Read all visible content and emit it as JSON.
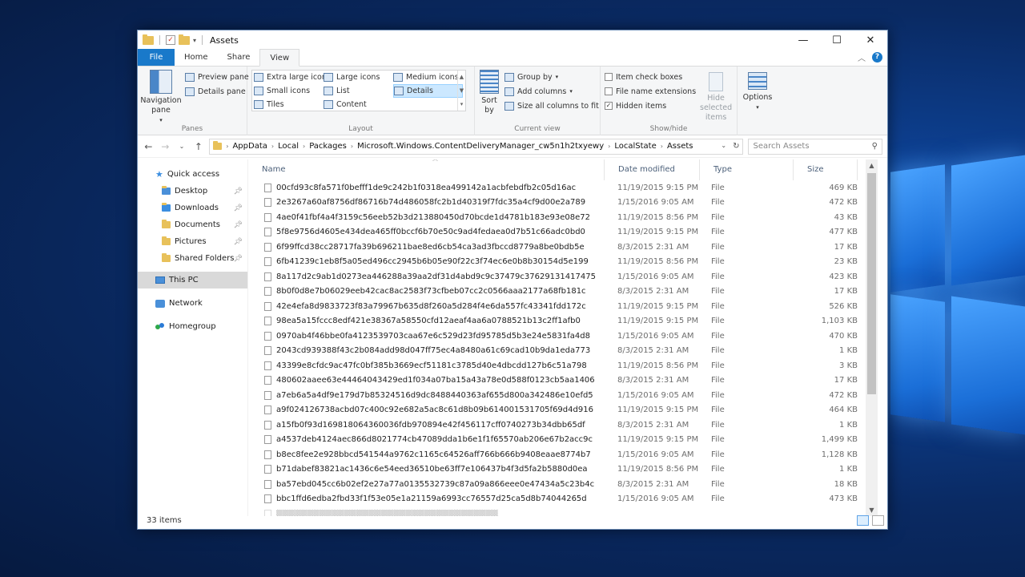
{
  "window": {
    "title": "Assets",
    "controls": {
      "minimize": "—",
      "maximize": "☐",
      "close": "✕"
    }
  },
  "tabs": [
    "File",
    "Home",
    "Share",
    "View"
  ],
  "active_tab": "View",
  "ribbon": {
    "panes": {
      "label": "Panes",
      "navigation_pane": "Navigation pane",
      "preview_pane": "Preview pane",
      "details_pane": "Details pane"
    },
    "layout": {
      "label": "Layout",
      "options": [
        "Extra large icons",
        "Large icons",
        "Medium icons",
        "Small icons",
        "List",
        "Details",
        "Tiles",
        "Content"
      ],
      "selected": "Details"
    },
    "current_view": {
      "label": "Current view",
      "sort_by": "Sort by",
      "group_by": "Group by",
      "add_columns": "Add columns",
      "size_all_columns": "Size all columns to fit"
    },
    "show_hide": {
      "label": "Show/hide",
      "item_check_boxes": "Item check boxes",
      "file_name_extensions": "File name extensions",
      "hidden_items": "Hidden items",
      "hide_selected_items": "Hide selected items"
    },
    "options": "Options"
  },
  "address": {
    "path": [
      "AppData",
      "Local",
      "Packages",
      "Microsoft.Windows.ContentDeliveryManager_cw5n1h2txyewy",
      "LocalState",
      "Assets"
    ],
    "search_placeholder": "Search Assets"
  },
  "nav": {
    "quick_access": "Quick access",
    "quick_items": [
      "Desktop",
      "Downloads",
      "Documents",
      "Pictures",
      "Shared Folders"
    ],
    "this_pc": "This PC",
    "network": "Network",
    "homegroup": "Homegroup"
  },
  "columns": {
    "name": "Name",
    "date": "Date modified",
    "type": "Type",
    "size": "Size"
  },
  "files": [
    {
      "name": "00cfd93c8fa571f0befff1de9c242b1f0318ea499142a1acbfebdfb2c05d16ac",
      "date": "11/19/2015 9:15 PM",
      "type": "File",
      "size": "469 KB"
    },
    {
      "name": "2e3267a60af8756df86716b74d486058fc2b1d40319f7fdc35a4cf9d00e2a789",
      "date": "1/15/2016 9:05 AM",
      "type": "File",
      "size": "472 KB"
    },
    {
      "name": "4ae0f41fbf4a4f3159c56eeb52b3d213880450d70bcde1d4781b183e93e08e72",
      "date": "11/19/2015 8:56 PM",
      "type": "File",
      "size": "43 KB"
    },
    {
      "name": "5f8e9756d4605e434dea465ff0bccf6b70e50c9ad4fedaea0d7b51c66adc0bd0",
      "date": "11/19/2015 9:15 PM",
      "type": "File",
      "size": "477 KB"
    },
    {
      "name": "6f99ffcd38cc28717fa39b696211bae8ed6cb54ca3ad3fbccd8779a8be0bdb5e",
      "date": "8/3/2015 2:31 AM",
      "type": "File",
      "size": "17 KB"
    },
    {
      "name": "6fb41239c1eb8f5a05ed496cc2945b6b05e90f22c3f74ec6e0b8b30154d5e199",
      "date": "11/19/2015 8:56 PM",
      "type": "File",
      "size": "23 KB"
    },
    {
      "name": "8a117d2c9ab1d0273ea446288a39aa2df31d4abd9c9c37479c37629131417475",
      "date": "1/15/2016 9:05 AM",
      "type": "File",
      "size": "423 KB"
    },
    {
      "name": "8b0f0d8e7b06029eeb42cac8ac2583f73cfbeb07cc2c0566aaa2177a68fb181c",
      "date": "8/3/2015 2:31 AM",
      "type": "File",
      "size": "17 KB"
    },
    {
      "name": "42e4efa8d9833723f83a79967b635d8f260a5d284f4e6da557fc43341fdd172c",
      "date": "11/19/2015 9:15 PM",
      "type": "File",
      "size": "526 KB"
    },
    {
      "name": "98ea5a15fccc8edf421e38367a58550cfd12aeaf4aa6a0788521b13c2ff1afb0",
      "date": "11/19/2015 9:15 PM",
      "type": "File",
      "size": "1,103 KB"
    },
    {
      "name": "0970ab4f46bbe0fa4123539703caa67e6c529d23fd95785d5b3e24e5831fa4d8",
      "date": "1/15/2016 9:05 AM",
      "type": "File",
      "size": "470 KB"
    },
    {
      "name": "2043cd939388f43c2b084add98d047ff75ec4a8480a61c69cad10b9da1eda773",
      "date": "8/3/2015 2:31 AM",
      "type": "File",
      "size": "1 KB"
    },
    {
      "name": "43399e8cfdc9ac47fc0bf385b3669ecf51181c3785d40e4dbcdd127b6c51a798",
      "date": "11/19/2015 8:56 PM",
      "type": "File",
      "size": "3 KB"
    },
    {
      "name": "480602aaee63e44464043429ed1f034a07ba15a43a78e0d588f0123cb5aa1406",
      "date": "8/3/2015 2:31 AM",
      "type": "File",
      "size": "17 KB"
    },
    {
      "name": "a7eb6a5a4df9e179d7b85324516d9dc8488440363af655d800a342486e10efd5",
      "date": "1/15/2016 9:05 AM",
      "type": "File",
      "size": "472 KB"
    },
    {
      "name": "a9f024126738acbd07c400c92e682a5ac8c61d8b09b614001531705f69d4d916",
      "date": "11/19/2015 9:15 PM",
      "type": "File",
      "size": "464 KB"
    },
    {
      "name": "a15fb0f93d169818064360036fdb970894e42f456117cff0740273b34dbb65df",
      "date": "8/3/2015 2:31 AM",
      "type": "File",
      "size": "1 KB"
    },
    {
      "name": "a4537deb4124aec866d8021774cb47089dda1b6e1f1f65570ab206e67b2acc9c",
      "date": "11/19/2015 9:15 PM",
      "type": "File",
      "size": "1,499 KB"
    },
    {
      "name": "b8ec8fee2e928bbcd541544a9762c1165c64526aff766b666b9408eaae8774b7",
      "date": "1/15/2016 9:05 AM",
      "type": "File",
      "size": "1,128 KB"
    },
    {
      "name": "b71dabef83821ac1436c6e54eed36510be63ff7e106437b4f3d5fa2b5880d0ea",
      "date": "11/19/2015 8:56 PM",
      "type": "File",
      "size": "1 KB"
    },
    {
      "name": "ba57ebd045cc6b02ef2e27a77a0135532739c87a09a866eee0e47434a5c23b4c",
      "date": "8/3/2015 2:31 AM",
      "type": "File",
      "size": "18 KB"
    },
    {
      "name": "bbc1ffd6edba2fbd33f1f53e05e1a21159a6993cc76557d25ca5d8b74044265d",
      "date": "1/15/2016 9:05 AM",
      "type": "File",
      "size": "473 KB"
    }
  ],
  "status": {
    "item_count": "33 items"
  },
  "colors": {
    "accent": "#1979ca",
    "selection": "#cce8ff"
  }
}
